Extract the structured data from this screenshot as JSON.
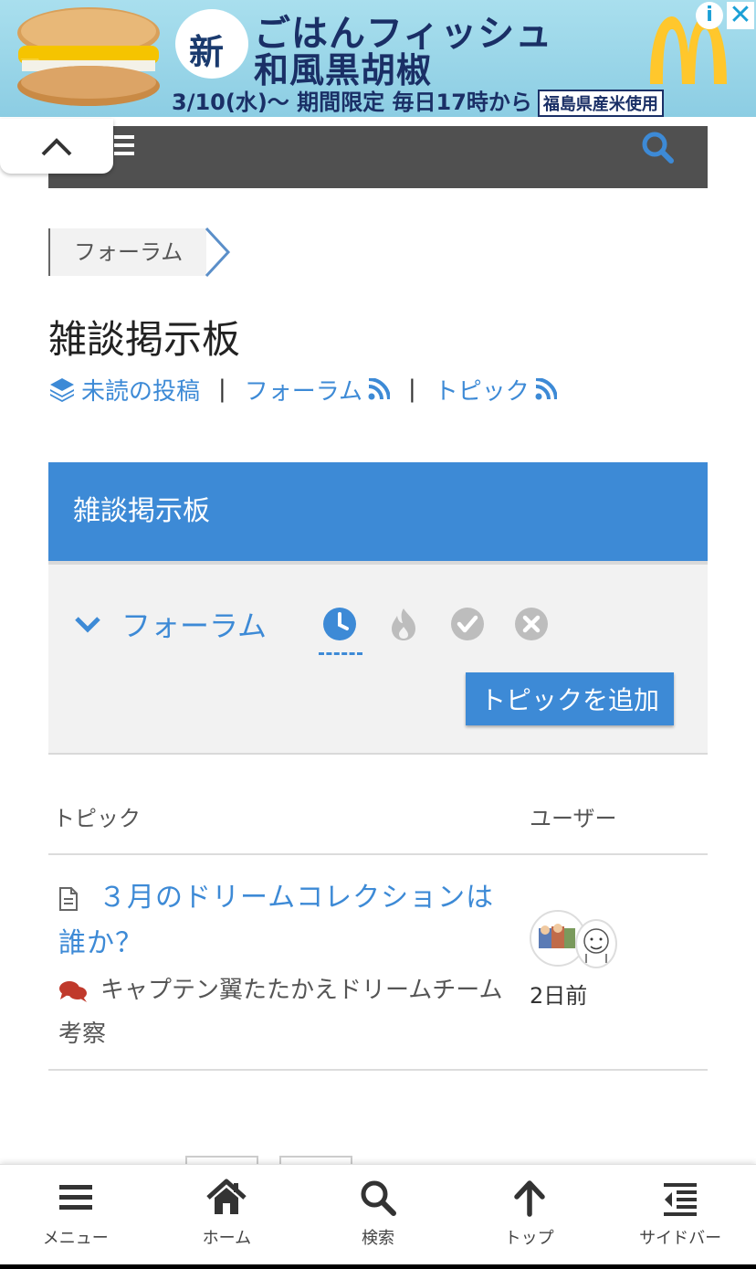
{
  "ad": {
    "new_badge": "新",
    "headline_1": "ごはんフィッシュ",
    "headline_2": "和風黒胡椒",
    "subline": "3/10(水)〜 期間限定 毎日17時から",
    "tag": "福島県産米使用",
    "info_icon": "info-icon",
    "close_icon": "close-icon",
    "brand_color": "#ffc72c"
  },
  "header": {
    "menu_icon": "hamburger-icon",
    "search_icon": "search-icon",
    "collapse_icon": "chevron-up-icon"
  },
  "breadcrumb": {
    "item": "フォーラム"
  },
  "page": {
    "title": "雑談掲示板",
    "links": {
      "unread": "未読の投稿",
      "forum": "フォーラム",
      "topic": "トピック",
      "separator": "|"
    }
  },
  "forum_panel": {
    "header": "雑談掲示板",
    "toggle_label": "フォーラム",
    "filters": [
      "clock-icon",
      "fire-icon",
      "check-icon",
      "x-icon"
    ],
    "add_button": "トピックを追加"
  },
  "table": {
    "col_topic": "トピック",
    "col_user": "ユーザー",
    "rows": [
      {
        "title": "３月のドリームコレクションは誰か？",
        "forum": "キャプテン翼たたかえドリームチーム考察",
        "time": "2日前"
      }
    ]
  },
  "bottom_nav": [
    {
      "label": "メニュー",
      "icon": "menu-icon"
    },
    {
      "label": "ホーム",
      "icon": "home-icon"
    },
    {
      "label": "検索",
      "icon": "search-icon"
    },
    {
      "label": "トップ",
      "icon": "arrow-up-icon"
    },
    {
      "label": "サイドバー",
      "icon": "sidebar-icon"
    }
  ],
  "colors": {
    "accent": "#3d8ad6",
    "header_bar": "#505050",
    "panel_bg": "#f2f2f2"
  }
}
